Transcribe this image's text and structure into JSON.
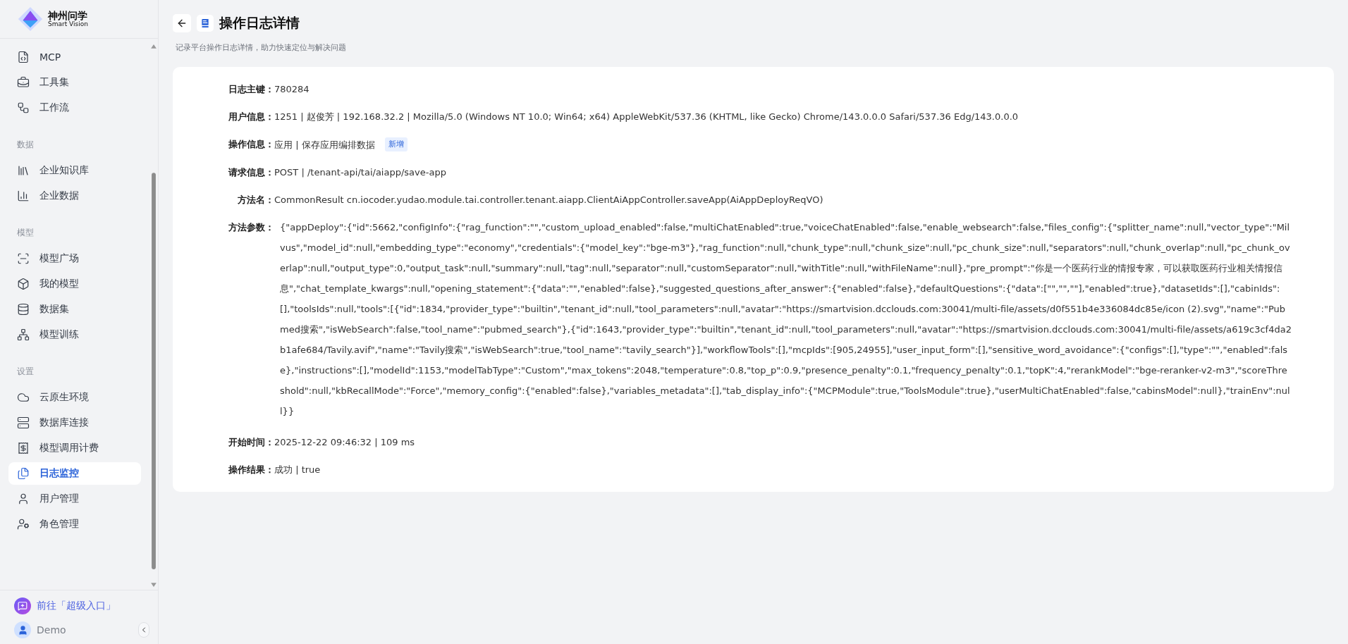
{
  "sidebar": {
    "logo": {
      "title": "神州问学",
      "subtitle": "Smart Vision"
    },
    "sections": [
      {
        "items": [
          {
            "label": "MCP",
            "selected": false
          },
          {
            "label": "工具集",
            "selected": false
          },
          {
            "label": "工作流",
            "selected": false
          }
        ]
      },
      {
        "label": "数据",
        "items": [
          {
            "label": "企业知识库",
            "selected": false
          },
          {
            "label": "企业数据",
            "selected": false
          }
        ]
      },
      {
        "label": "模型",
        "items": [
          {
            "label": "模型广场",
            "selected": false
          },
          {
            "label": "我的模型",
            "selected": false
          },
          {
            "label": "数据集",
            "selected": false
          },
          {
            "label": "模型训练",
            "selected": false
          }
        ]
      },
      {
        "label": "设置",
        "items": [
          {
            "label": "云原生环境",
            "selected": false
          },
          {
            "label": "数据库连接",
            "selected": false
          },
          {
            "label": "模型调用计费",
            "selected": false
          },
          {
            "label": "日志监控",
            "selected": true
          },
          {
            "label": "用户管理",
            "selected": false
          },
          {
            "label": "角色管理",
            "selected": false
          }
        ]
      }
    ],
    "footer": {
      "entry": "前往「超级入口」",
      "user": "Demo"
    }
  },
  "page": {
    "title": "操作日志详情",
    "subtitle": "记录平台操作日志详情，助力快速定位与解决问题"
  },
  "fields": [
    {
      "label": "日志主键：",
      "value": "780284"
    },
    {
      "label": "用户信息：",
      "value": "1251 | 赵俊芳 | 192.168.32.2 | Mozilla/5.0 (Windows NT 10.0; Win64; x64) AppleWebKit/537.36 (KHTML, like Gecko) Chrome/143.0.0.0 Safari/537.36 Edg/143.0.0.0"
    },
    {
      "label": "操作信息：",
      "value": "应用 | 保存应用编排数据",
      "tag": "新增"
    },
    {
      "label": "请求信息：",
      "value": "POST | /tenant-api/tai/aiapp/save-app"
    },
    {
      "label": "方法名：",
      "value": "CommonResult cn.iocoder.yudao.module.tai.controller.tenant.aiapp.ClientAiAppController.saveApp(AiAppDeployReqVO)"
    },
    {
      "label": "方法参数：",
      "value": "{\"appDeploy\":{\"id\":5662,\"configInfo\":{\"rag_function\":\"\",\"custom_upload_enabled\":false,\"multiChatEnabled\":true,\"voiceChatEnabled\":false,\"enable_websearch\":false,\"files_config\":{\"splitter_name\":null,\"vector_type\":\"Milvus\",\"model_id\":null,\"embedding_type\":\"economy\",\"credentials\":{\"model_key\":\"bge-m3\"},\"rag_function\":null,\"chunk_type\":null,\"chunk_size\":null,\"pc_chunk_size\":null,\"separators\":null,\"chunk_overlap\":null,\"pc_chunk_overlap\":null,\"output_type\":0,\"output_task\":null,\"summary\":null,\"tag\":null,\"separator\":null,\"customSeparator\":null,\"withTitle\":null,\"withFileName\":null},\"pre_prompt\":\"你是一个医药行业的情报专家，可以获取医药行业相关情报信息\",\"chat_template_kwargs\":null,\"opening_statement\":{\"data\":\"\",\"enabled\":false},\"suggested_questions_after_answer\":{\"enabled\":false},\"defaultQuestions\":{\"data\":[\"\",\"\",\"\"],\"enabled\":true},\"datasetIds\":[],\"cabinIds\":[],\"toolsIds\":null,\"tools\":[{\"id\":1834,\"provider_type\":\"builtin\",\"tenant_id\":null,\"tool_parameters\":null,\"avatar\":\"https://smartvision.dcclouds.com:30041/multi-file/assets/d0f551b4e336084dc85e/icon (2).svg\",\"name\":\"Pubmed搜索\",\"isWebSearch\":false,\"tool_name\":\"pubmed_search\"},{\"id\":1643,\"provider_type\":\"builtin\",\"tenant_id\":null,\"tool_parameters\":null,\"avatar\":\"https://smartvision.dcclouds.com:30041/multi-file/assets/a619c3cf4da2b1afe684/Tavily.avif\",\"name\":\"Tavily搜索\",\"isWebSearch\":true,\"tool_name\":\"tavily_search\"}],\"workflowTools\":[],\"mcpIds\":[905,24955],\"user_input_form\":[],\"sensitive_word_avoidance\":{\"configs\":[],\"type\":\"\",\"enabled\":false},\"instructions\":[],\"modelId\":1153,\"modelTabType\":\"Custom\",\"max_tokens\":2048,\"temperature\":0.8,\"top_p\":0.9,\"presence_penalty\":0.1,\"frequency_penalty\":0.1,\"topK\":4,\"rerankModel\":\"bge-reranker-v2-m3\",\"scoreThreshold\":null,\"kbRecallMode\":\"Force\",\"memory_config\":{\"enabled\":false},\"variables_metadata\":[],\"tab_display_info\":{\"MCPModule\":true,\"ToolsModule\":true},\"userMultiChatEnabled\":false,\"cabinsModel\":null},\"trainEnv\":null}}"
    },
    {
      "label": "开始时间：",
      "value": "2025-12-22 09:46:32 | 109 ms"
    },
    {
      "label": "操作结果：",
      "value": "成功 | true"
    }
  ]
}
